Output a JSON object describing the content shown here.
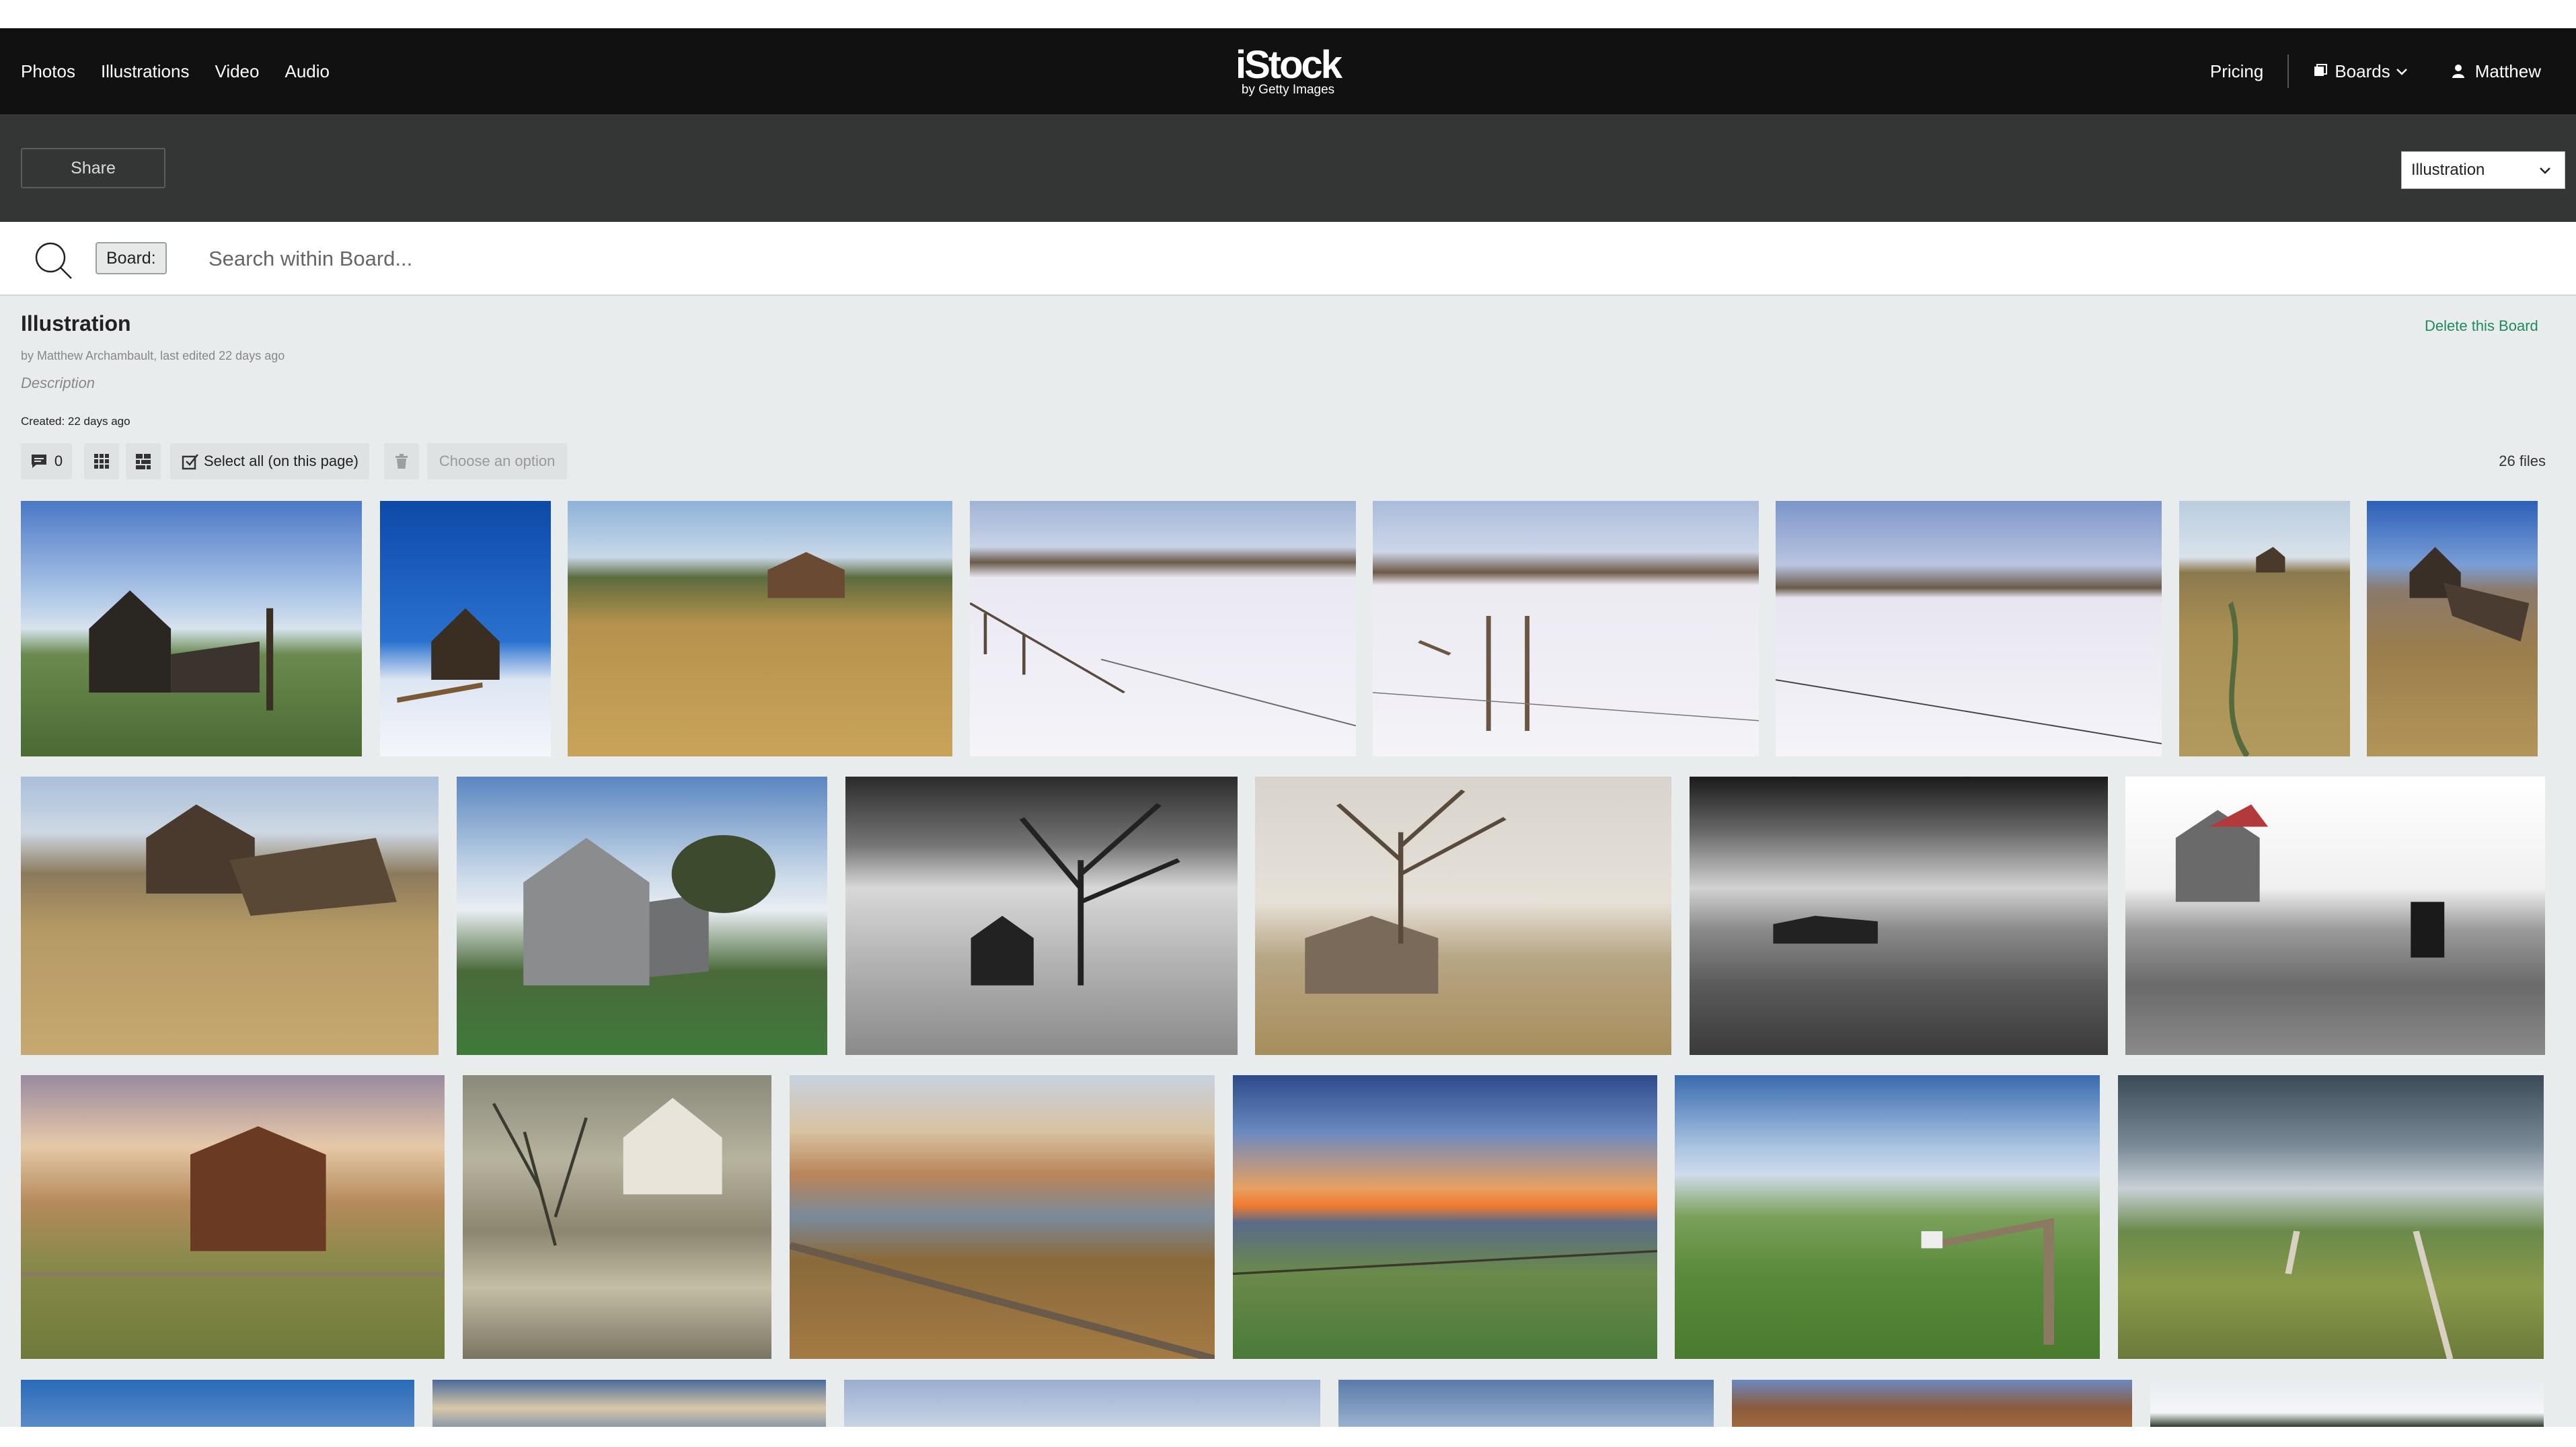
{
  "nav": {
    "links": [
      "Photos",
      "Illustrations",
      "Video",
      "Audio"
    ],
    "logo_main": "iStock",
    "logo_sub": "by Getty Images",
    "pricing": "Pricing",
    "boards": "Boards",
    "user": "Matthew"
  },
  "toolbar": {
    "share": "Share",
    "board_select": "Illustration"
  },
  "search": {
    "tag": "Board:",
    "placeholder": "Search within Board..."
  },
  "board": {
    "title": "Illustration",
    "byline": "by Matthew Archambault, last edited 22 days ago",
    "description": "Description",
    "created": "Created: 22 days ago",
    "delete": "Delete this Board",
    "comments_count": "0",
    "select_all": "Select all (on this page)",
    "choose_option": "Choose an option",
    "file_count": "26 files"
  },
  "colors": {
    "nav_bg": "#111111",
    "toolbar_bg": "#343636",
    "page_bg": "#e9ecec",
    "delete_link": "#1f8a5a"
  }
}
